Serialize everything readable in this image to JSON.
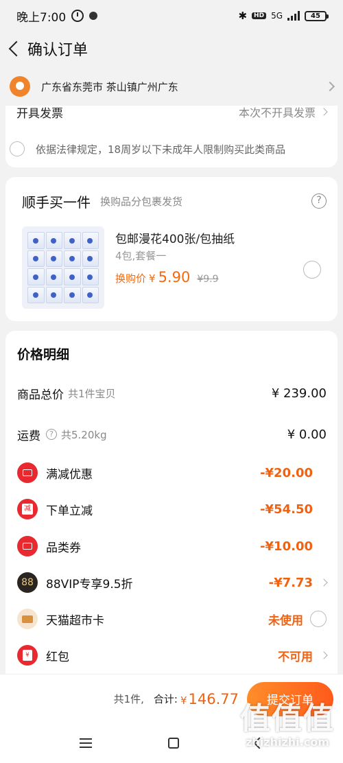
{
  "status_bar": {
    "time": "晚上7:00",
    "network": "5G",
    "battery": "45"
  },
  "nav": {
    "title": "确认订单"
  },
  "address": {
    "text": "广东省东莞市 茶山镇广州广东"
  },
  "invoice": {
    "label": "开具发票",
    "value": "本次不开具发票"
  },
  "age_notice": {
    "text": "依据法律规定，18周岁以下未成年人限制购买此类商品"
  },
  "addon": {
    "title": "顺手买一件",
    "subtitle": "换购品分包裹发货",
    "help": "?",
    "product": {
      "name": "包邮漫花400张/包抽纸",
      "spec": "4包,套餐一",
      "price_label": "换购价",
      "currency": "¥",
      "price": "5.90",
      "original_price": "¥9.9"
    }
  },
  "price_detail": {
    "title": "价格明细",
    "total_goods": {
      "label": "商品总价",
      "sub": "共1件宝贝",
      "amount": "¥ 239.00"
    },
    "shipping": {
      "label": "运费",
      "sub": "共5.20kg",
      "amount": "¥ 0.00"
    },
    "discounts": [
      {
        "label": "满减优惠",
        "amount": "-¥20.00"
      },
      {
        "label": "下单立减",
        "amount": "-¥54.50",
        "badge_text": "减"
      },
      {
        "label": "品类券",
        "amount": "-¥10.00"
      },
      {
        "label": "88VIP专享9.5折",
        "amount": "-¥7.73",
        "badge_text": "88"
      }
    ],
    "tmall_card": {
      "label": "天猫超市卡",
      "status": "未使用"
    },
    "red_packet": {
      "label": "红包",
      "status": "不可用",
      "badge_text": "¥"
    }
  },
  "submit_bar": {
    "count": "共1件,",
    "total_label": "合计:",
    "currency": "¥",
    "total": "146.77",
    "submit_label": "提交订单"
  },
  "watermark": {
    "logo": "值值值",
    "url": "zhizhizhi.com"
  },
  "colors": {
    "accent": "#f0620f",
    "badge_red": "#e8292f",
    "pin": "#f0842c"
  }
}
